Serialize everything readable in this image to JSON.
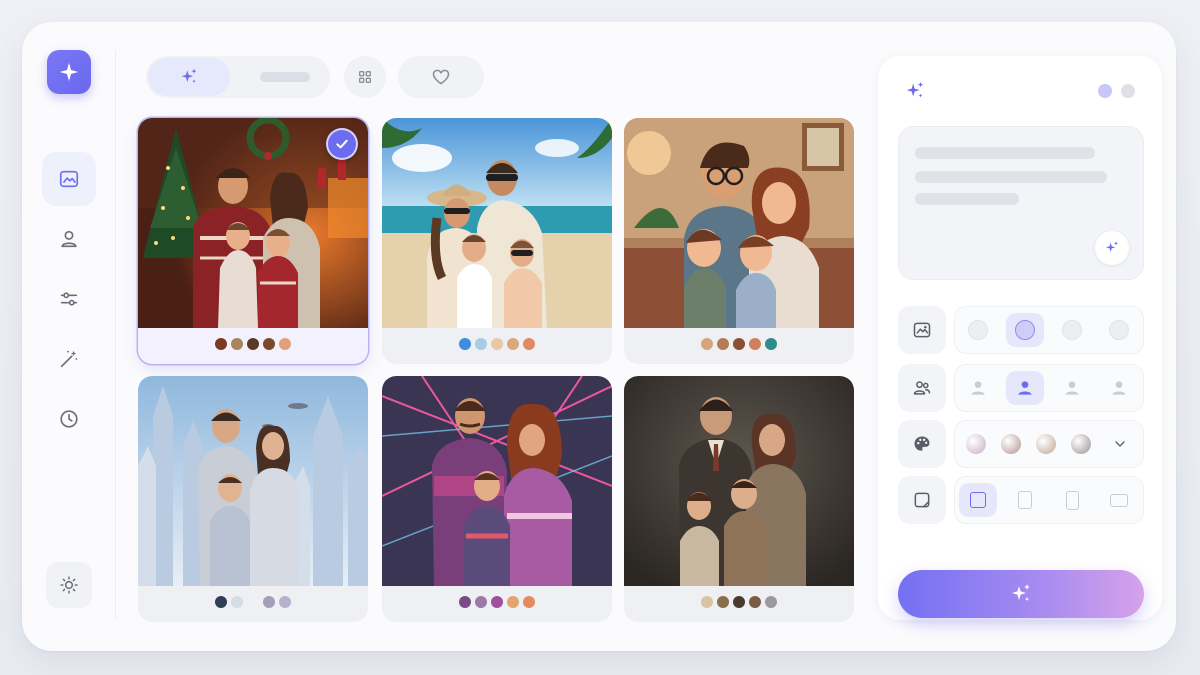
{
  "sidebar": {
    "logo_icon": "sparkle-icon",
    "items": [
      {
        "icon": "image-icon",
        "active": true
      },
      {
        "icon": "user-icon",
        "active": false
      },
      {
        "icon": "sliders-icon",
        "active": false
      },
      {
        "icon": "magic-wand-icon",
        "active": false
      },
      {
        "icon": "clock-icon",
        "active": false
      }
    ],
    "footer_icon": "sun-icon"
  },
  "toolbar": {
    "tabs": [
      {
        "icon": "sparkles-icon",
        "active": true
      },
      {
        "icon": "placeholder",
        "active": false
      }
    ],
    "grid_icon": "grid-icon",
    "favorites_icon": "heart-icon"
  },
  "gallery": {
    "cards": [
      {
        "style": "christmas",
        "selected": true,
        "swatches": [
          "#7a3a22",
          "#a8855a",
          "#5a3a24",
          "#7b4a2b",
          "#e2a07a"
        ]
      },
      {
        "style": "beach",
        "selected": false,
        "swatches": [
          "#3f8de0",
          "#a7cce6",
          "#e8c9a3",
          "#d9a97c",
          "#e08a63"
        ]
      },
      {
        "style": "cartoon",
        "selected": false,
        "swatches": [
          "#d6a57a",
          "#b57a56",
          "#8a4f34",
          "#d07f5f",
          "#2f8c8c"
        ]
      },
      {
        "style": "sci-fi",
        "selected": false,
        "swatches": [
          "#2f3f55",
          "#d7dbe3",
          "#eef1f6",
          "#a39fb8",
          "#b7b1d0"
        ]
      },
      {
        "style": "retro-80s",
        "selected": false,
        "swatches": [
          "#7a4c83",
          "#9c79a8",
          "#a0509a",
          "#e2a56f",
          "#e58a5d"
        ]
      },
      {
        "style": "vintage",
        "selected": false,
        "swatches": [
          "#d9c3a0",
          "#8a6f4e",
          "#4a3a2e",
          "#7a5c44",
          "#9a9a9a"
        ]
      }
    ]
  },
  "panel": {
    "header_icon": "sparkles-icon",
    "dots": [
      "#c9c7f6",
      "#dfe0e6"
    ],
    "prompt": {
      "enhance_icon": "sparkles-icon"
    },
    "options": [
      {
        "icon": "image-icon",
        "selected_index": 1,
        "kind": "circles"
      },
      {
        "icon": "people-icon",
        "selected_index": 1,
        "kind": "persons"
      },
      {
        "icon": "palette-icon",
        "selected_index": -1,
        "kind": "colors",
        "more_icon": "chevron-down-icon",
        "colors": [
          "#d8c4d8",
          "#c8b4b0",
          "#d2c0b0",
          "#b8b0b4"
        ]
      },
      {
        "icon": "aspect-ratio-icon",
        "selected_index": 0,
        "kind": "ratios"
      }
    ],
    "generate_icon": "sparkles-icon"
  },
  "colors": {
    "accent": "#6d6bf0",
    "accent_light": "#e7e7fb"
  }
}
